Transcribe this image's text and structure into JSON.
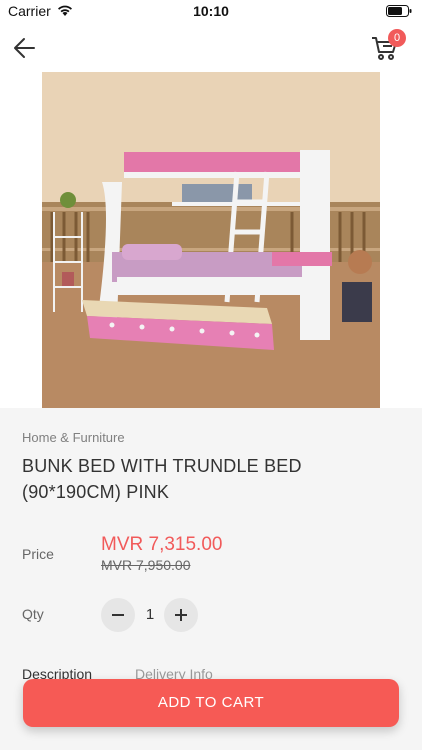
{
  "status": {
    "carrier": "Carrier",
    "time": "10:10"
  },
  "nav": {
    "cart_count": "0"
  },
  "product": {
    "category": "Home & Furniture",
    "title": "BUNK BED WITH TRUNDLE BED (90*190CM) PINK",
    "price_label": "Price",
    "price": "MVR 7,315.00",
    "old_price": "MVR 7,950.00",
    "qty_label": "Qty",
    "qty": "1"
  },
  "tabs": {
    "description": "Description",
    "delivery": "Delivery Info"
  },
  "actions": {
    "add_to_cart": "ADD TO CART"
  },
  "colors": {
    "accent": "#f15a5a",
    "button": "#f65a55"
  }
}
